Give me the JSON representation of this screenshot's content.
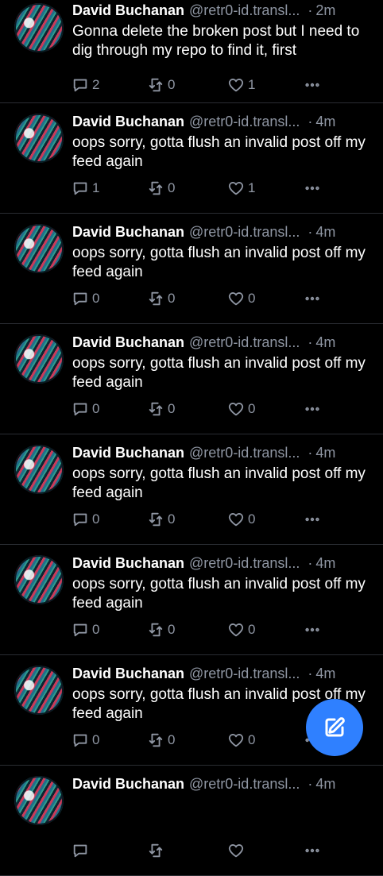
{
  "colors": {
    "background": "#000000",
    "muted": "#8f96a3",
    "accent": "#2f80ff",
    "divider": "#2a2d33"
  },
  "posts": [
    {
      "name": "David Buchanan",
      "handle": "@retr0-id.transl...",
      "time": "2m",
      "text": "Gonna delete the broken post but I need to dig through my repo to find it, first",
      "replies": "2",
      "reposts": "0",
      "likes": "1"
    },
    {
      "name": "David Buchanan",
      "handle": "@retr0-id.transl...",
      "time": "4m",
      "text": "oops sorry, gotta flush an invalid post off my feed again",
      "replies": "1",
      "reposts": "0",
      "likes": "1"
    },
    {
      "name": "David Buchanan",
      "handle": "@retr0-id.transl...",
      "time": "4m",
      "text": "oops sorry, gotta flush an invalid post off my feed again",
      "replies": "0",
      "reposts": "0",
      "likes": "0"
    },
    {
      "name": "David Buchanan",
      "handle": "@retr0-id.transl...",
      "time": "4m",
      "text": "oops sorry, gotta flush an invalid post off my feed again",
      "replies": "0",
      "reposts": "0",
      "likes": "0"
    },
    {
      "name": "David Buchanan",
      "handle": "@retr0-id.transl...",
      "time": "4m",
      "text": "oops sorry, gotta flush an invalid post off my feed again",
      "replies": "0",
      "reposts": "0",
      "likes": "0"
    },
    {
      "name": "David Buchanan",
      "handle": "@retr0-id.transl...",
      "time": "4m",
      "text": "oops sorry, gotta flush an invalid post off my feed again",
      "replies": "0",
      "reposts": "0",
      "likes": "0"
    },
    {
      "name": "David Buchanan",
      "handle": "@retr0-id.transl...",
      "time": "4m",
      "text": "oops sorry, gotta flush an invalid post off my feed again",
      "replies": "0",
      "reposts": "0",
      "likes": "0"
    },
    {
      "name": "David Buchanan",
      "handle": "@retr0-id.transl...",
      "time": "4m",
      "text": "",
      "replies": "",
      "reposts": "",
      "likes": ""
    }
  ],
  "compose": {
    "icon": "compose-icon"
  }
}
